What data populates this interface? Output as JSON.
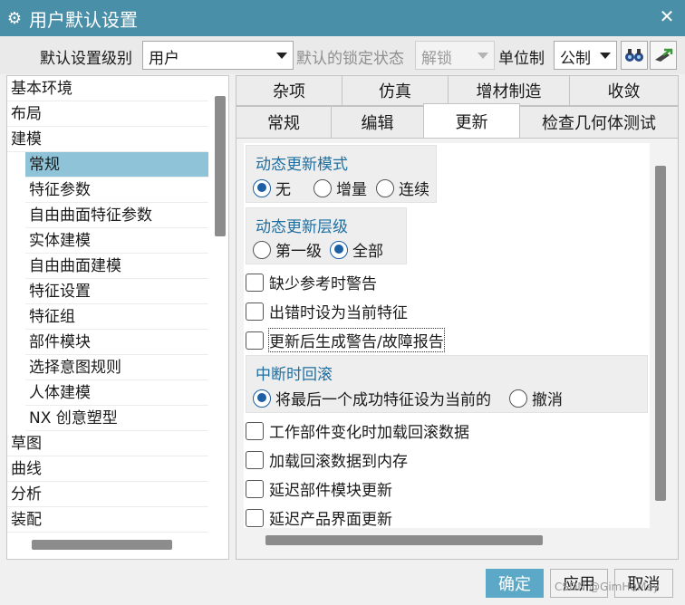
{
  "window": {
    "title": "用户默认设置",
    "icon": "gear-icon",
    "close_icon": "close-icon",
    "title_bg": "#4a8fa8"
  },
  "topbar": {
    "level_label": "默认设置级别",
    "level_value": "用户",
    "lock_label": "默认的锁定状态",
    "lock_value": "解锁",
    "unit_label": "单位制",
    "unit_value": "公制",
    "tool_icons": [
      "binoculars-icon",
      "import-export-icon"
    ]
  },
  "tree": [
    {
      "label": "基本环境",
      "level": 0
    },
    {
      "label": "布局",
      "level": 0
    },
    {
      "label": "建模",
      "level": 0
    },
    {
      "label": "常规",
      "level": 1,
      "selected": true
    },
    {
      "label": "特征参数",
      "level": 1
    },
    {
      "label": "自由曲面特征参数",
      "level": 1
    },
    {
      "label": "实体建模",
      "level": 1
    },
    {
      "label": "自由曲面建模",
      "level": 1
    },
    {
      "label": "特征设置",
      "level": 1
    },
    {
      "label": "特征组",
      "level": 1
    },
    {
      "label": "部件模块",
      "level": 1
    },
    {
      "label": "选择意图规则",
      "level": 1
    },
    {
      "label": "人体建模",
      "level": 1
    },
    {
      "label": "NX 创意塑型",
      "level": 1
    },
    {
      "label": "草图",
      "level": 0
    },
    {
      "label": "曲线",
      "level": 0
    },
    {
      "label": "分析",
      "level": 0
    },
    {
      "label": "装配",
      "level": 0
    }
  ],
  "tabs": {
    "row1": [
      "杂项",
      "仿真",
      "增材制造",
      "收敛"
    ],
    "row2": [
      "常规",
      "编辑",
      "更新",
      "检查几何体测试"
    ],
    "active": "更新"
  },
  "update_mode": {
    "title": "动态更新模式",
    "options": [
      "无",
      "增量",
      "连续"
    ],
    "selected": "无"
  },
  "update_level": {
    "title": "动态更新层级",
    "options": [
      "第一级",
      "全部"
    ],
    "selected": "全部"
  },
  "checks_a": [
    "缺少参考时警告",
    "出错时设为当前特征",
    "更新后生成警告/故障报告"
  ],
  "interrupt": {
    "title": "中断时回滚",
    "options": [
      "将最后一个成功特征设为当前的",
      "撤消"
    ],
    "selected": "将最后一个成功特征设为当前的"
  },
  "checks_b": [
    "工作部件变化时加载回滚数据",
    "加载回滚数据到内存",
    "延迟部件模块更新",
    "延迟产品界面更新"
  ],
  "buttons": {
    "ok": "确定",
    "apply": "应用",
    "cancel": "取消"
  },
  "accent_color": "#5ca8c7",
  "watermark": "CSDN @GimHuMay"
}
